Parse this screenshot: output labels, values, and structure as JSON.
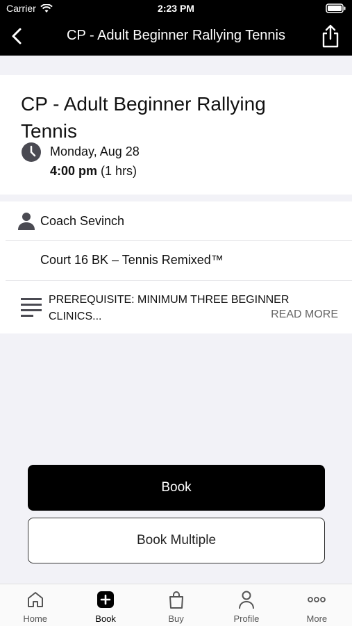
{
  "status_bar": {
    "carrier": "Carrier",
    "time": "2:23 PM"
  },
  "nav": {
    "title": "CP - Adult Beginner Rallying Tennis",
    "back_icon": "chevron-left-icon",
    "share_icon": "share-icon"
  },
  "event": {
    "title": "CP - Adult Beginner Rallying Tennis",
    "date": "Monday, Aug 28",
    "time": "4:00 pm",
    "duration": "(1 hrs)",
    "coach": "Coach Sevinch",
    "court": "Court 16 BK – Tennis Remixed™",
    "description": "PREREQUISITE: MINIMUM THREE BEGINNER CLINICS...",
    "read_more": "READ MORE"
  },
  "actions": {
    "book": "Book",
    "book_multiple": "Book Multiple"
  },
  "tabs": [
    {
      "label": "Home",
      "icon": "home-icon"
    },
    {
      "label": "Book",
      "icon": "plus-square-icon"
    },
    {
      "label": "Buy",
      "icon": "shopping-bag-icon"
    },
    {
      "label": "Profile",
      "icon": "person-icon"
    },
    {
      "label": "More",
      "icon": "more-dots-icon"
    }
  ],
  "colors": {
    "header": "#000000",
    "background": "#f2f2f7",
    "primary_button": "#000000"
  }
}
